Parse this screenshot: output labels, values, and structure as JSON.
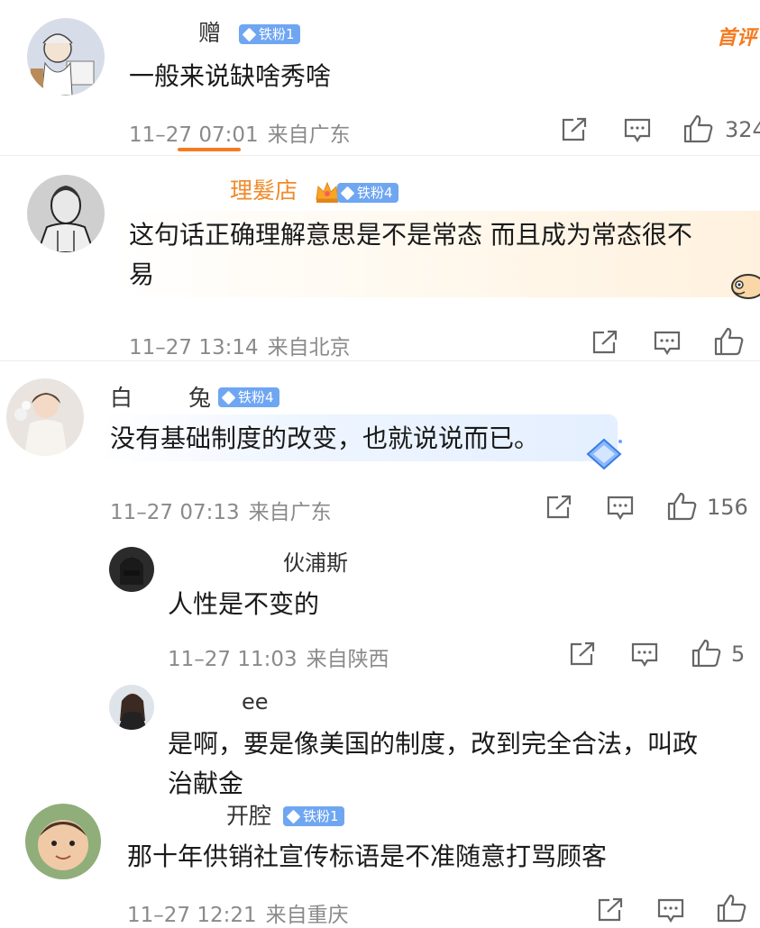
{
  "top_right_label": "首评",
  "comments": [
    {
      "username": "赠",
      "badge": "铁粉1",
      "text": "一般来说缺啥秀啥",
      "date": "11–27 07:01",
      "location": "来自广东",
      "likes": "324"
    },
    {
      "username": "理髮店",
      "badge": "铁粉4",
      "text_line1": "这句话正确理解意思是不是常态 而且成为常态很不",
      "text_line2": "易",
      "date": "11–27 13:14",
      "location": "来自北京",
      "likes": ""
    },
    {
      "username_left": "白",
      "username_right": "兔",
      "badge": "铁粉4",
      "text": "没有基础制度的改变，也就说说而已。",
      "date": "11–27 07:13",
      "location": "来自广东",
      "likes": "156"
    },
    {
      "username": "伙浦斯",
      "text": "人性是不变的",
      "date": "11–27 11:03",
      "location": "来自陕西",
      "likes": "5"
    },
    {
      "username": "ee",
      "text_line1": "是啊，要是像美国的制度，改到完全合法，叫政",
      "text_line2": "治献金",
      "date": "",
      "location": "",
      "likes": ""
    },
    {
      "username": "开腔",
      "badge": "铁粉1",
      "text": "那十年供销社宣传标语是不准随意打骂顾客",
      "date": "11–27 12:21",
      "location": "来自重庆",
      "likes": ""
    }
  ],
  "colors": {
    "badge_blue": "#6fa6f2",
    "accent_orange": "#f57b20",
    "meta_grey": "#8a8a8a"
  }
}
